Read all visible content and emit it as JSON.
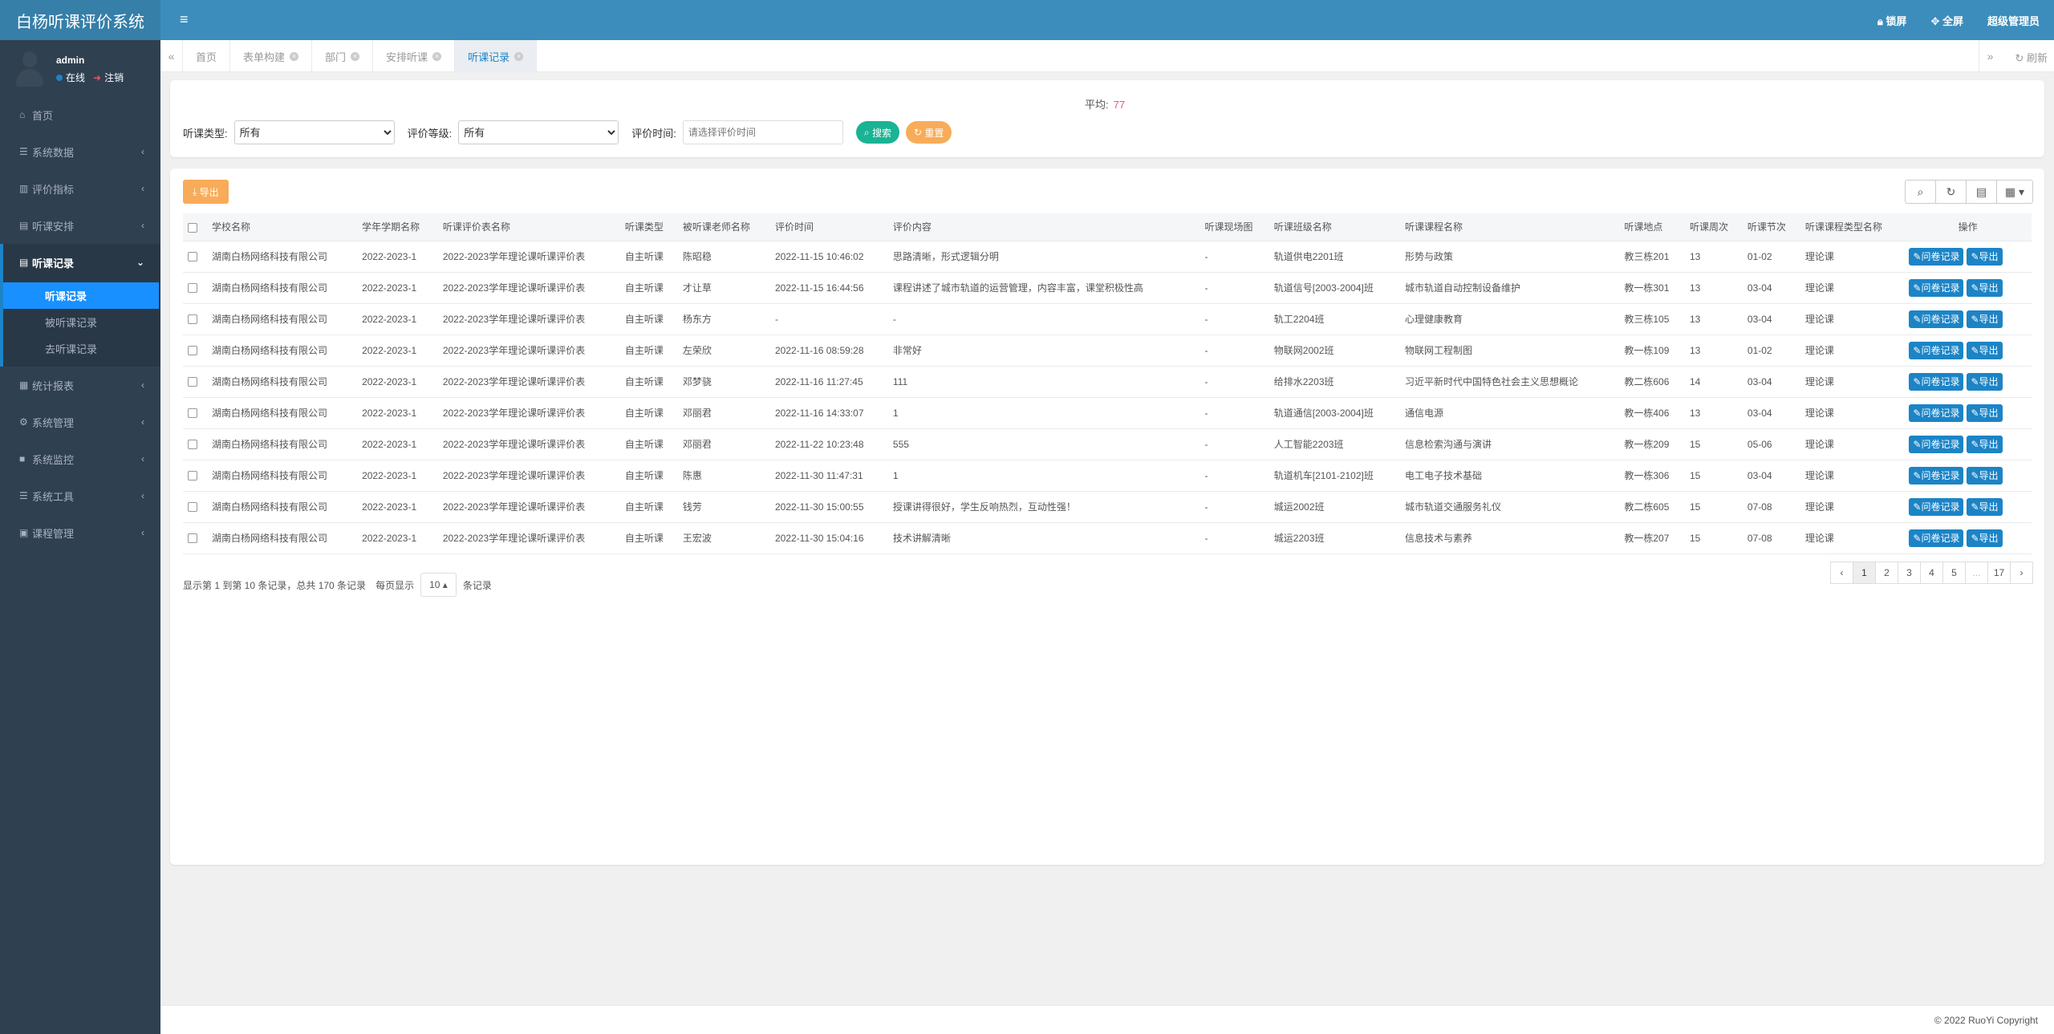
{
  "app": {
    "title": "白杨听课评价系统"
  },
  "user": {
    "name": "admin",
    "status_online": "在线",
    "logout": "注销"
  },
  "sidebar": {
    "items": [
      {
        "icon": "home-icon",
        "glyph": "⌂",
        "label": "首页",
        "has_children": false
      },
      {
        "icon": "database-icon",
        "glyph": "☰",
        "label": "系统数据",
        "has_children": true
      },
      {
        "icon": "bar-chart-icon",
        "glyph": "▥",
        "label": "评价指标",
        "has_children": true
      },
      {
        "icon": "calendar-icon",
        "glyph": "▤",
        "label": "听课安排",
        "has_children": true
      },
      {
        "icon": "list-icon",
        "glyph": "▤",
        "label": "听课记录",
        "has_children": true,
        "open": true
      },
      {
        "icon": "stats-icon",
        "glyph": "▦",
        "label": "统计报表",
        "has_children": true
      },
      {
        "icon": "gear-icon",
        "glyph": "⚙",
        "label": "系统管理",
        "has_children": true
      },
      {
        "icon": "video-icon",
        "glyph": "■",
        "label": "系统监控",
        "has_children": true
      },
      {
        "icon": "tools-icon",
        "glyph": "☰",
        "label": "系统工具",
        "has_children": true
      },
      {
        "icon": "course-icon",
        "glyph": "▣",
        "label": "课程管理",
        "has_children": true
      }
    ],
    "submenu": [
      "听课记录",
      "被听课记录",
      "去听课记录"
    ]
  },
  "topbar": {
    "lock": "锁屏",
    "fullscreen": "全屏",
    "role": "超级管理员"
  },
  "tabs": [
    {
      "label": "首页",
      "closable": false
    },
    {
      "label": "表单构建",
      "closable": true
    },
    {
      "label": "部门",
      "closable": true
    },
    {
      "label": "安排听课",
      "closable": true
    },
    {
      "label": "听课记录",
      "closable": true,
      "active": true
    }
  ],
  "tab_refresh": "刷新",
  "search": {
    "avg_label": "平均:",
    "avg_value": "77",
    "type_label": "听课类型:",
    "type_value": "所有",
    "level_label": "评价等级:",
    "level_value": "所有",
    "time_label": "评价时间:",
    "time_placeholder": "请选择评价时间",
    "search_btn": "搜索",
    "reset_btn": "重置"
  },
  "toolbar": {
    "export": "导出"
  },
  "table": {
    "headers": [
      "学校名称",
      "学年学期名称",
      "听课评价表名称",
      "听课类型",
      "被听课老师名称",
      "评价时间",
      "评价内容",
      "听课现场图",
      "听课班级名称",
      "听课课程名称",
      "听课地点",
      "听课周次",
      "听课节次",
      "听课课程类型名称",
      "操作"
    ],
    "op_record": "问卷记录",
    "op_export": "导出",
    "rows": [
      [
        "湖南白杨网络科技有限公司",
        "2022-2023-1",
        "2022-2023学年理论课听课评价表",
        "自主听课",
        "陈昭稳",
        "2022-11-15 10:46:02",
        "思路清晰，形式逻辑分明",
        "-",
        "轨道供电2201班",
        "形势与政策",
        "教三栋201",
        "13",
        "01-02",
        "理论课"
      ],
      [
        "湖南白杨网络科技有限公司",
        "2022-2023-1",
        "2022-2023学年理论课听课评价表",
        "自主听课",
        "才让草",
        "2022-11-15 16:44:56",
        "课程讲述了城市轨道的运营管理，内容丰富，课堂积极性高",
        "-",
        "轨道信号[2003-2004]班",
        "城市轨道自动控制设备维护",
        "教一栋301",
        "13",
        "03-04",
        "理论课"
      ],
      [
        "湖南白杨网络科技有限公司",
        "2022-2023-1",
        "2022-2023学年理论课听课评价表",
        "自主听课",
        "杨东方",
        "-",
        "-",
        "-",
        "轨工2204班",
        "心理健康教育",
        "教三栋105",
        "13",
        "03-04",
        "理论课"
      ],
      [
        "湖南白杨网络科技有限公司",
        "2022-2023-1",
        "2022-2023学年理论课听课评价表",
        "自主听课",
        "左荣欣",
        "2022-11-16 08:59:28",
        "非常好",
        "-",
        "物联网2002班",
        "物联网工程制图",
        "教一栋109",
        "13",
        "01-02",
        "理论课"
      ],
      [
        "湖南白杨网络科技有限公司",
        "2022-2023-1",
        "2022-2023学年理论课听课评价表",
        "自主听课",
        "邓梦骁",
        "2022-11-16 11:27:45",
        "111",
        "-",
        "给排水2203班",
        "习近平新时代中国特色社会主义思想概论",
        "教二栋606",
        "14",
        "03-04",
        "理论课"
      ],
      [
        "湖南白杨网络科技有限公司",
        "2022-2023-1",
        "2022-2023学年理论课听课评价表",
        "自主听课",
        "邓丽君",
        "2022-11-16 14:33:07",
        "1",
        "-",
        "轨道通信[2003-2004]班",
        "通信电源",
        "教一栋406",
        "13",
        "03-04",
        "理论课"
      ],
      [
        "湖南白杨网络科技有限公司",
        "2022-2023-1",
        "2022-2023学年理论课听课评价表",
        "自主听课",
        "邓丽君",
        "2022-11-22 10:23:48",
        "555",
        "-",
        "人工智能2203班",
        "信息检索沟通与演讲",
        "教一栋209",
        "15",
        "05-06",
        "理论课"
      ],
      [
        "湖南白杨网络科技有限公司",
        "2022-2023-1",
        "2022-2023学年理论课听课评价表",
        "自主听课",
        "陈惠",
        "2022-11-30 11:47:31",
        "1",
        "-",
        "轨道机车[2101-2102]班",
        "电工电子技术基础",
        "教一栋306",
        "15",
        "03-04",
        "理论课"
      ],
      [
        "湖南白杨网络科技有限公司",
        "2022-2023-1",
        "2022-2023学年理论课听课评价表",
        "自主听课",
        "钱芳",
        "2022-11-30 15:00:55",
        "授课讲得很好，学生反响热烈，互动性强！",
        "-",
        "城运2002班",
        "城市轨道交通服务礼仪",
        "教二栋605",
        "15",
        "07-08",
        "理论课"
      ],
      [
        "湖南白杨网络科技有限公司",
        "2022-2023-1",
        "2022-2023学年理论课听课评价表",
        "自主听课",
        "王宏波",
        "2022-11-30 15:04:16",
        "技术讲解清晰",
        "-",
        "城运2203班",
        "信息技术与素养",
        "教一栋207",
        "15",
        "07-08",
        "理论课"
      ]
    ]
  },
  "pager": {
    "info": "显示第 1 到第 10 条记录，总共 170 条记录",
    "per_page_prefix": "每页显示",
    "per_page": "10",
    "per_page_suffix": "条记录",
    "pages": [
      "‹",
      "1",
      "2",
      "3",
      "4",
      "5",
      "...",
      "17",
      "›"
    ],
    "current": "1"
  },
  "footer": "© 2022 RuoYi Copyright"
}
